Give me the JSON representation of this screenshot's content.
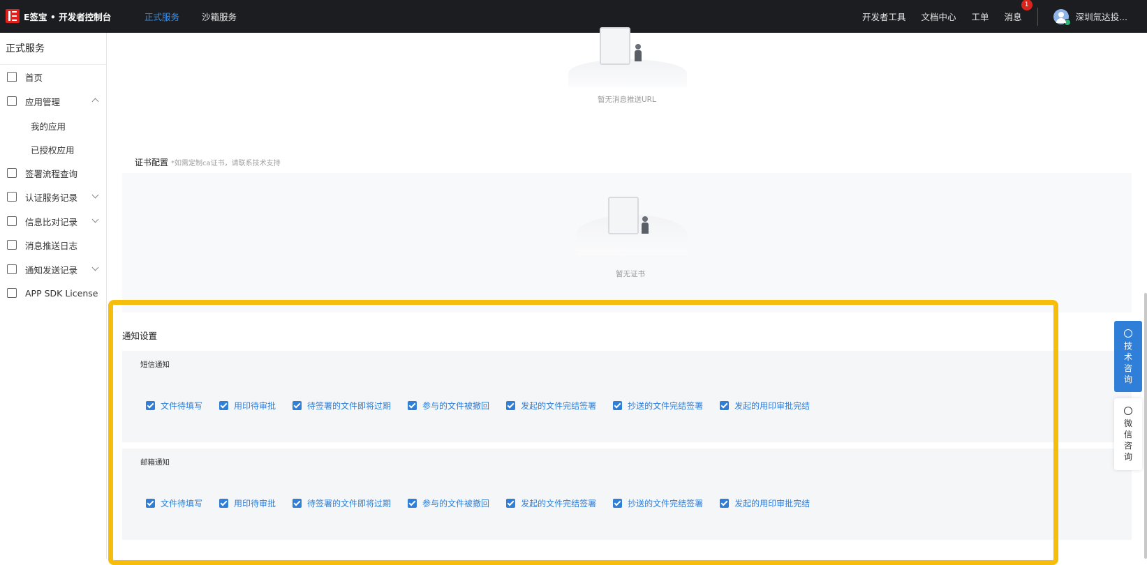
{
  "topbar": {
    "logo": "E签宝 • 开发者控制台",
    "nav": [
      "正式服务",
      "沙箱服务"
    ],
    "right": {
      "dev_tools": "开发者工具",
      "docs": "文档中心",
      "tickets": "工单",
      "messages": "消息",
      "messages_badge": "1",
      "user": "深圳氚达投..."
    }
  },
  "sidebar": {
    "title": "正式服务",
    "items": [
      {
        "label": "首页"
      },
      {
        "label": "应用管理"
      },
      {
        "label": "我的应用"
      },
      {
        "label": "已授权应用"
      },
      {
        "label": "签署流程查询"
      },
      {
        "label": "认证服务记录"
      },
      {
        "label": "信息比对记录"
      },
      {
        "label": "消息推送日志"
      },
      {
        "label": "通知发送记录"
      },
      {
        "label": "APP SDK License"
      }
    ]
  },
  "main": {
    "push_empty": "暂无消息推送URL",
    "cert": {
      "title": "证书配置",
      "hint": "*如需定制ca证书，请联系技术支持",
      "empty": "暂无证书"
    },
    "notice": {
      "title": "通知设置",
      "sms": {
        "title": "短信通知",
        "options": [
          "文件待填写",
          "用印待审批",
          "待签署的文件即将过期",
          "参与的文件被撤回",
          "发起的文件完结签署",
          "抄送的文件完结签署",
          "发起的用印审批完结"
        ]
      },
      "email": {
        "title": "邮箱通知",
        "options": [
          "文件待填写",
          "用印待审批",
          "待签署的文件即将过期",
          "参与的文件被撤回",
          "发起的文件完结签署",
          "抄送的文件完结签署",
          "发起的用印审批完结"
        ]
      }
    }
  },
  "floats": {
    "tech": [
      "技",
      "术",
      "咨",
      "询"
    ],
    "wechat": [
      "微",
      "信",
      "咨",
      "询"
    ]
  },
  "colors": {
    "accent": "#2f7ed8",
    "highlight": "#f7bd0b",
    "topbar": "#1b1d21",
    "brand": "#e0201b"
  }
}
